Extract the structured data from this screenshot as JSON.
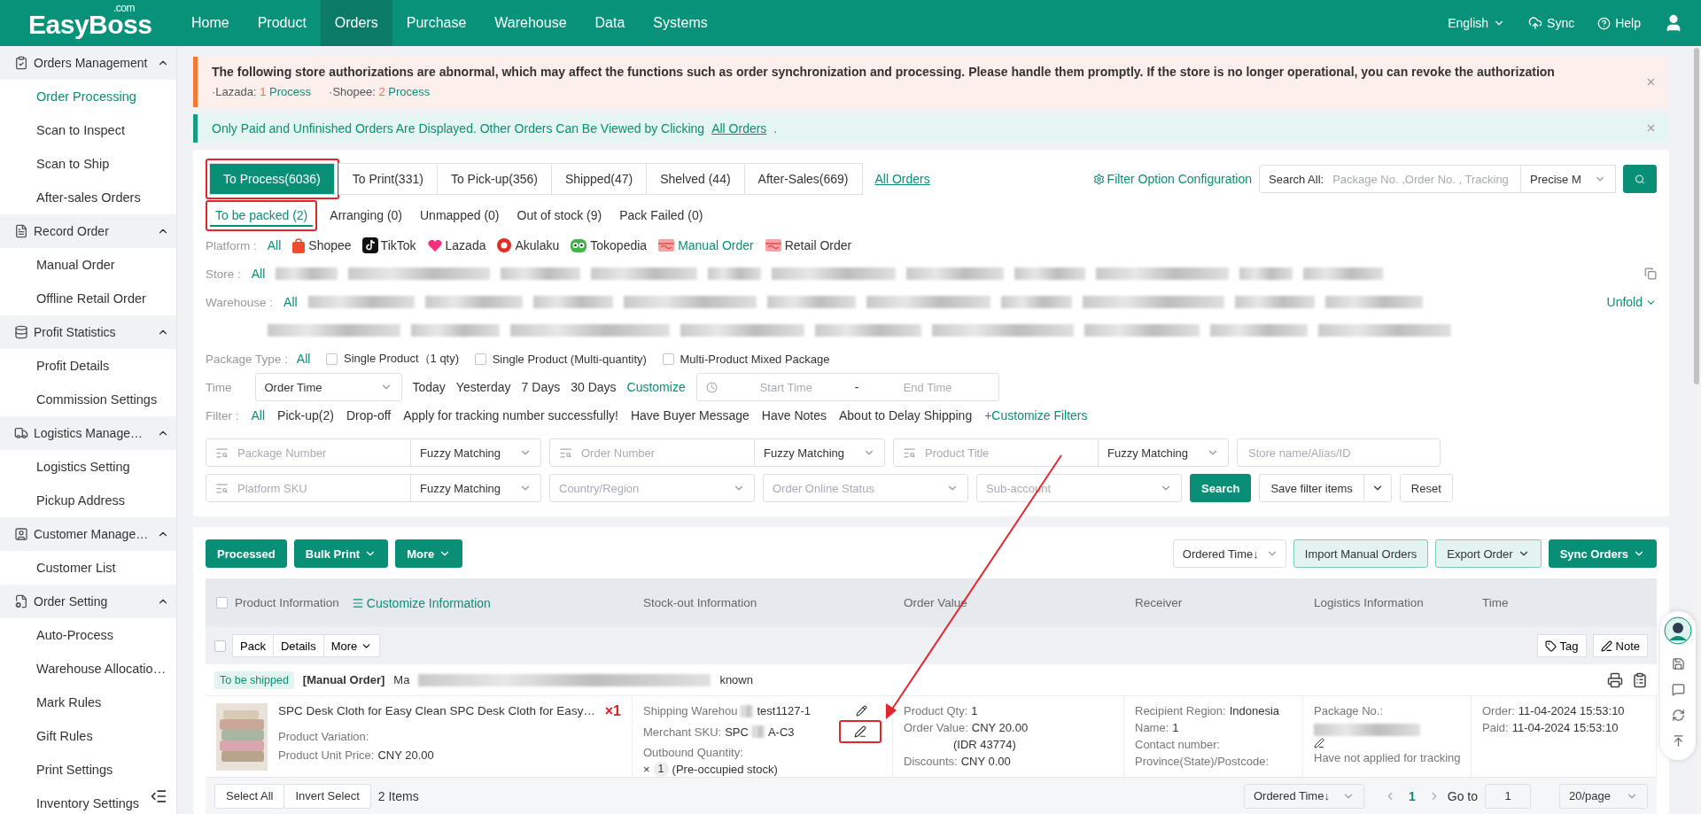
{
  "header": {
    "logo": "EasyBoss",
    "logo_suffix": ".com",
    "nav": [
      {
        "label": "Home",
        "selected": false
      },
      {
        "label": "Product",
        "selected": false
      },
      {
        "label": "Orders",
        "selected": true
      },
      {
        "label": "Purchase",
        "selected": false
      },
      {
        "label": "Warehouse",
        "selected": false
      },
      {
        "label": "Data",
        "selected": false
      },
      {
        "label": "Systems",
        "selected": false
      }
    ],
    "language": "English",
    "sync": "Sync",
    "help": "Help"
  },
  "sidebar": {
    "groups": [
      {
        "title": "Orders Management",
        "expanded": true,
        "items": [
          {
            "label": "Order Processing",
            "selected": true
          },
          {
            "label": "Scan to Inspect",
            "selected": false
          },
          {
            "label": "Scan to Ship",
            "selected": false
          },
          {
            "label": "After-sales Orders",
            "selected": false
          }
        ]
      },
      {
        "title": "Record Order",
        "expanded": true,
        "items": [
          {
            "label": "Manual Order",
            "selected": false
          },
          {
            "label": "Offline Retail Order",
            "selected": false
          }
        ]
      },
      {
        "title": "Profit Statistics",
        "expanded": true,
        "items": [
          {
            "label": "Profit Details",
            "selected": false
          },
          {
            "label": "Commission Settings",
            "selected": false
          }
        ]
      },
      {
        "title": "Logistics Manage…",
        "expanded": true,
        "items": [
          {
            "label": "Logistics Setting",
            "selected": false
          },
          {
            "label": "Pickup Address",
            "selected": false
          }
        ]
      },
      {
        "title": "Customer Manage…",
        "expanded": true,
        "items": [
          {
            "label": "Customer List",
            "selected": false
          }
        ]
      },
      {
        "title": "Order Setting",
        "expanded": true,
        "items": [
          {
            "label": "Auto-Process",
            "selected": false
          },
          {
            "label": "Warehouse Allocatio…",
            "selected": false
          },
          {
            "label": "Mark Rules",
            "selected": false
          },
          {
            "label": "Gift Rules",
            "selected": false
          },
          {
            "label": "Print Settings",
            "selected": false
          },
          {
            "label": "Inventory Settings",
            "selected": false
          }
        ]
      }
    ]
  },
  "alerts": [
    {
      "kind": "warning",
      "text": "The following store authorizations are abnormal, which may affect the functions such as order synchronization and processing. Please handle them promptly. If the store is no longer operational, you can revoke the authorization",
      "stores": [
        {
          "name": "·Lazada:",
          "count": "1",
          "action": "Process"
        },
        {
          "name": "·Shopee:",
          "count": "2",
          "action": "Process"
        }
      ]
    },
    {
      "kind": "notice",
      "text": "Only Paid and Unfinished Orders Are Displayed. Other Orders Can Be Viewed by Clicking",
      "link": "All Orders",
      "suffix": "."
    }
  ],
  "status_tabs": [
    {
      "label": "To Process(6036)",
      "selected": true,
      "highlighted": true
    },
    {
      "label": "To Print(331)",
      "selected": false,
      "highlighted": false
    },
    {
      "label": "To Pick-up(356)",
      "selected": false,
      "highlighted": false
    },
    {
      "label": "Shipped(47)",
      "selected": false,
      "highlighted": false
    },
    {
      "label": "Shelved (44)",
      "selected": false,
      "highlighted": false
    },
    {
      "label": "After-Sales(669)",
      "selected": false,
      "highlighted": false
    }
  ],
  "all_orders_link": "All Orders",
  "filter_config": "Filter Option Configuration",
  "global_search": {
    "label": "Search All:",
    "placeholder": "Package No. ,Order No. , Tracking",
    "mode": "Precise M"
  },
  "sub_tabs": [
    {
      "label": "To be packed (2)",
      "selected": true,
      "highlighted": true
    },
    {
      "label": "Arranging (0)",
      "selected": false,
      "highlighted": false
    },
    {
      "label": "Unmapped (0)",
      "selected": false,
      "highlighted": false
    },
    {
      "label": "Out of stock (9)",
      "selected": false,
      "highlighted": false
    },
    {
      "label": "Pack Failed (0)",
      "selected": false,
      "highlighted": false
    }
  ],
  "platform": {
    "label": "Platform :",
    "options": [
      {
        "label": "All",
        "kind": "all",
        "selected": true
      },
      {
        "label": "Shopee",
        "kind": "shopee",
        "selected": false
      },
      {
        "label": "TikTok",
        "kind": "tiktok",
        "selected": false
      },
      {
        "label": "Lazada",
        "kind": "lazada",
        "selected": false
      },
      {
        "label": "Akulaku",
        "kind": "akulaku",
        "selected": false
      },
      {
        "label": "Tokopedia",
        "kind": "tokopedia",
        "selected": false
      },
      {
        "label": "Manual Order",
        "kind": "manual",
        "selected": true
      },
      {
        "label": "Retail Order",
        "kind": "manual",
        "selected": false
      }
    ]
  },
  "store": {
    "label": "Store :",
    "all": "All"
  },
  "warehouse": {
    "label": "Warehouse :",
    "all": "All",
    "unfold": "Unfold"
  },
  "package_type": {
    "label": "Package Type :",
    "all": "All",
    "options": [
      {
        "label": "Single Product（1 qty)",
        "checked": false
      },
      {
        "label": "Single Product (Multi-quantity)",
        "checked": false
      },
      {
        "label": "Multi-Product Mixed Package",
        "checked": false
      }
    ]
  },
  "time": {
    "label": "Time",
    "select": "Order Time",
    "options": [
      {
        "label": "Today",
        "selected": false
      },
      {
        "label": "Yesterday",
        "selected": false
      },
      {
        "label": "7 Days",
        "selected": false
      },
      {
        "label": "30 Days",
        "selected": false
      },
      {
        "label": "Customize",
        "selected": true
      }
    ],
    "start_placeholder": "Start Time",
    "separator": "-",
    "end_placeholder": "End Time"
  },
  "filter": {
    "label": "Filter :",
    "options": [
      {
        "label": "All",
        "selected": true
      },
      {
        "label": "Pick-up(2)",
        "selected": false
      },
      {
        "label": "Drop-off",
        "selected": false
      },
      {
        "label": "Apply for tracking number successfully!",
        "selected": false
      },
      {
        "label": "Have Buyer Message",
        "selected": false
      },
      {
        "label": "Have Notes",
        "selected": false
      },
      {
        "label": "About to Delay Shipping",
        "selected": false
      }
    ],
    "add": "+Customize Filters"
  },
  "search_rows": [
    [
      {
        "kind": "combo",
        "placeholder": "Package Number",
        "match": "Fuzzy Matching"
      },
      {
        "kind": "combo",
        "placeholder": "Order Number",
        "match": "Fuzzy Matching"
      },
      {
        "kind": "combo",
        "placeholder": "Product Title",
        "match": "Fuzzy Matching"
      },
      {
        "kind": "text",
        "placeholder": "Store name/Alias/ID"
      }
    ],
    [
      {
        "kind": "combo",
        "placeholder": "Platform SKU",
        "match": "Fuzzy Matching"
      },
      {
        "kind": "select",
        "placeholder": "Country/Region"
      },
      {
        "kind": "select",
        "placeholder": "Order Online Status"
      },
      {
        "kind": "select",
        "placeholder": "Sub-account"
      }
    ]
  ],
  "search_buttons": {
    "search": "Search",
    "save": "Save filter items",
    "reset": "Reset"
  },
  "toolbar": {
    "left": [
      {
        "label": "Processed",
        "dropdown": false
      },
      {
        "label": "Bulk Print",
        "dropdown": true
      },
      {
        "label": "More",
        "dropdown": true
      }
    ],
    "sort": "Ordered Time↓",
    "right": [
      {
        "label": "Import Manual Orders",
        "kind": "light",
        "dropdown": false
      },
      {
        "label": "Export Order",
        "kind": "light",
        "dropdown": true
      },
      {
        "label": "Sync Orders",
        "kind": "solid",
        "dropdown": true
      }
    ]
  },
  "table": {
    "header_checked": false,
    "batch_checked": false,
    "columns": [
      "Product Information",
      "Stock-out Information",
      "Order Value",
      "Receiver",
      "Logistics Information",
      "Time"
    ],
    "customize": "Customize Information",
    "batch_actions": [
      "Pack",
      "Details",
      "More"
    ],
    "tag": "Tag",
    "note": "Note",
    "order": {
      "status": "To be shipped",
      "type": "[Manual Order]",
      "number_start": "Ma",
      "number_end": "known",
      "product": {
        "title": "SPC Desk Cloth for Easy Clean SPC Desk Cloth for Easy…",
        "qty": "×1",
        "variation": "Product Variation:",
        "price_label": "Product Unit Price:",
        "price": "CNY 20.00"
      },
      "stock": {
        "warehouse_label": "Shipping Warehou",
        "warehouse_end": "test1127-1",
        "sku_label": "Merchant SKU:",
        "sku_start": "SPC",
        "sku_end": "A-C3",
        "outbound": "Outbound Quantity:",
        "times": "×",
        "count": "1",
        "stock_note": "(Pre-occupied stock)",
        "edit_highlighted": true
      },
      "value": [
        {
          "label": "Product Qty:",
          "value": "1"
        },
        {
          "label": "Order Value:",
          "value": "CNY 20.00"
        },
        {
          "value": "(IDR 43774)"
        },
        {
          "label": "Discounts:",
          "value": "CNY 0.00"
        }
      ],
      "receiver": [
        {
          "label": "Recipient Region:",
          "value": "Indonesia"
        },
        {
          "label": "Name:",
          "value": "1"
        },
        {
          "label": "Contact number:"
        },
        {
          "label": "Province(State)/Postcode:"
        }
      ],
      "logistics": {
        "package_label": "Package No.:",
        "tracking": "Have not applied for tracking"
      },
      "time": [
        {
          "label": "Order:",
          "value": "11-04-2024 15:53:10"
        },
        {
          "label": "Paid:",
          "value": "11-04-2024 15:53:10"
        }
      ]
    }
  },
  "footer": {
    "select_all": "Select All",
    "invert": "Invert Select",
    "count": "2 Items",
    "sort": "Ordered Time↓",
    "pages": [
      {
        "label": "1",
        "selected": true
      }
    ],
    "goto": "Go to",
    "goto_value": "1",
    "page_size": "20/page"
  }
}
